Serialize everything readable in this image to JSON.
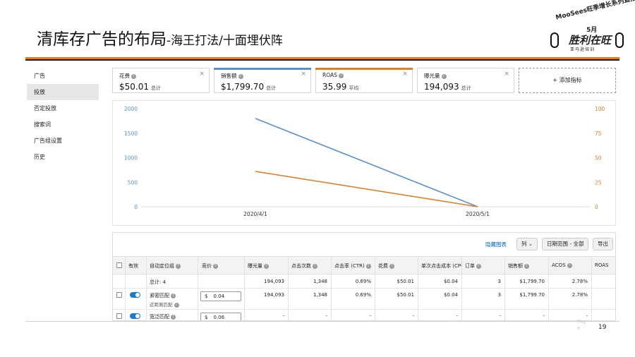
{
  "slide": {
    "title_main": "清库存广告的布局",
    "title_sub": "-海王打法/十面埋伏阵",
    "page_number": "19",
    "watermark": "Pag\ne"
  },
  "logo": {
    "line1": "MooSees旺季增长系列直播",
    "line2": "5月",
    "line3": "胜利在旺",
    "line4": "亚马逊培训"
  },
  "colors": {
    "accent_orange": "#e87722",
    "sales_blue": "#5b8fc7",
    "roas_orange": "#d9822b",
    "toggle_blue": "#1f7acc",
    "link_blue": "#0066c0"
  },
  "sidebar": {
    "items": [
      {
        "label": "广告",
        "active": false
      },
      {
        "label": "投放",
        "active": true
      },
      {
        "label": "否定投放",
        "active": false
      },
      {
        "label": "搜索词",
        "active": false
      },
      {
        "label": "广告组设置",
        "active": false
      },
      {
        "label": "历史",
        "active": false
      }
    ]
  },
  "metrics": [
    {
      "label": "花费",
      "value": "$50.01",
      "unit": "总计",
      "accent": ""
    },
    {
      "label": "销售额",
      "value": "$1,799.70",
      "unit": "总计",
      "accent": "#5b8fc7"
    },
    {
      "label": "ROAS",
      "value": "35.99",
      "unit": "平均",
      "accent": "#d9822b"
    },
    {
      "label": "曝光量",
      "value": "194,093",
      "unit": "总计",
      "accent": ""
    }
  ],
  "add_metric_label": "+ 添加指标",
  "close_icon_glyph": "×",
  "chart_data": {
    "type": "line",
    "x": [
      "2020/4/1",
      "2020/5/1"
    ],
    "series": [
      {
        "values": [
          1799.7,
          0
        ],
        "axis": "left",
        "color": "#5b8fc7"
      },
      {
        "values": [
          35.99,
          0
        ],
        "axis": "right",
        "color": "#d9822b"
      }
    ],
    "y_left_ticks": [
      "2000",
      "1500",
      "1000",
      "500",
      "0"
    ],
    "y_right_ticks": [
      "100",
      "75",
      "50",
      "25",
      "0"
    ],
    "ylim_left": [
      0,
      2000
    ],
    "ylim_right": [
      0,
      100
    ],
    "grid": false
  },
  "table_toolbar": {
    "hide_chart": "隐藏图表",
    "columns": "列",
    "date_range": "日期范围 - 全部",
    "export": "导出"
  },
  "table": {
    "headers": [
      "有效",
      "自动定位组",
      "竞价",
      "曝光量",
      "点击次数",
      "点击率 (CTR)",
      "花费",
      "单次点击成本 (CPC)",
      "订单",
      "销售额",
      "ACOS",
      "ROAS"
    ],
    "total_row": {
      "label": "总计: 4",
      "impressions": "194,093",
      "clicks": "1,348",
      "ctr": "0.69%",
      "spend": "$50.01",
      "cpc": "$0.04",
      "orders": "3",
      "sales": "$1,799.70",
      "acos": "2.78%"
    },
    "rows": [
      {
        "name": "紧密匹配",
        "sub": "近距离匹配",
        "currency": "$",
        "bid": "0.04",
        "impressions": "194,093",
        "clicks": "1,348",
        "ctr": "0.69%",
        "spend": "$50.01",
        "cpc": "$0.04",
        "orders": "3",
        "sales": "$1,799.70",
        "acos": "2.78%"
      },
      {
        "name": "宽泛匹配",
        "sub": "",
        "currency": "$",
        "bid": "0.06",
        "impressions": "-",
        "clicks": "-",
        "ctr": "-",
        "spend": "-",
        "cpc": "-",
        "orders": "-",
        "sales": "-",
        "acos": "-"
      }
    ]
  }
}
